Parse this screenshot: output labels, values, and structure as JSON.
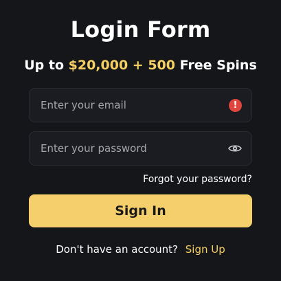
{
  "header": {
    "title": "Login Form",
    "promo_prefix": "Up to",
    "promo_amount": "$20,000 + 500",
    "promo_suffix": "Free Spins"
  },
  "form": {
    "email_placeholder": "Enter your email",
    "email_value": "",
    "email_status_icon": "alert-icon",
    "password_placeholder": "Enter your password",
    "password_value": "",
    "password_toggle_icon": "eye-icon",
    "forgot_label": "Forgot your password?",
    "signin_label": "Sign In"
  },
  "footer": {
    "prompt": "Don't have an account?",
    "signup_label": "Sign Up"
  },
  "colors": {
    "background": "#15161a",
    "accent": "#f5cf62",
    "button": "#f5cf6b",
    "error": "#e0463e"
  }
}
